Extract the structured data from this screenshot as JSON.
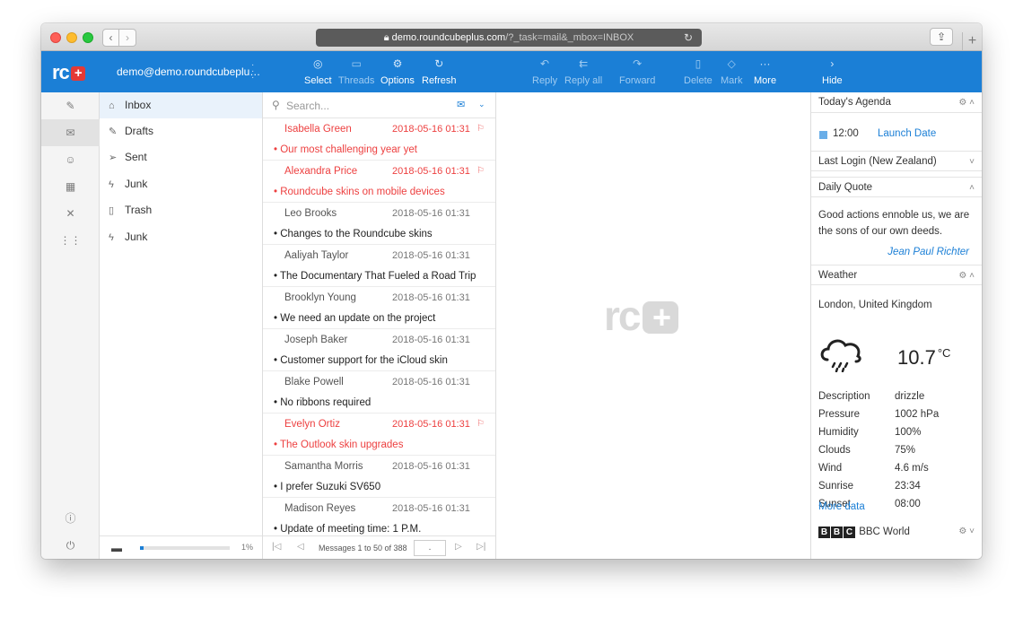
{
  "browser": {
    "url_host": "demo.roundcubeplus.com",
    "url_path": "/?_task=mail&_mbox=INBOX"
  },
  "toolbar": {
    "user": "demo@demo.roundcubeplu…",
    "buttons_left": [
      {
        "label": "Select",
        "icon": "check-circle-icon",
        "enabled": true
      },
      {
        "label": "Threads",
        "icon": "threads-icon",
        "enabled": false
      },
      {
        "label": "Options",
        "icon": "gear-icon",
        "enabled": true
      },
      {
        "label": "Refresh",
        "icon": "refresh-icon",
        "enabled": true
      }
    ],
    "buttons_right": [
      {
        "label": "Reply",
        "icon": "reply-icon",
        "enabled": false
      },
      {
        "label": "Reply all",
        "icon": "reply-all-icon",
        "enabled": false
      },
      {
        "label": "Forward",
        "icon": "forward-icon",
        "enabled": false
      },
      {
        "label": "Delete",
        "icon": "trash-icon",
        "enabled": false
      },
      {
        "label": "Mark",
        "icon": "tag-icon",
        "enabled": false
      },
      {
        "label": "More",
        "icon": "more-icon",
        "enabled": true
      },
      {
        "label": "Hide",
        "icon": "chevron-right-icon",
        "enabled": true
      }
    ]
  },
  "folders": [
    {
      "name": "Inbox",
      "icon": "inbox-icon",
      "active": true
    },
    {
      "name": "Drafts",
      "icon": "edit-icon",
      "active": false
    },
    {
      "name": "Sent",
      "icon": "send-icon",
      "active": false
    },
    {
      "name": "Junk",
      "icon": "junk-icon",
      "active": false
    },
    {
      "name": "Trash",
      "icon": "trash-icon",
      "active": false
    },
    {
      "name": "Junk",
      "icon": "junk-icon",
      "active": false
    }
  ],
  "quota": {
    "percent_label": "1%",
    "fill": 0.04
  },
  "search": {
    "placeholder": "Search..."
  },
  "messages": [
    {
      "from": "Isabella Green",
      "date": "2018-05-16 01:31",
      "subject": "Our most challenging year yet",
      "flagged": true
    },
    {
      "from": "Alexandra Price",
      "date": "2018-05-16 01:31",
      "subject": "Roundcube skins on mobile devices",
      "flagged": true
    },
    {
      "from": "Leo Brooks",
      "date": "2018-05-16 01:31",
      "subject": "Changes to the Roundcube skins",
      "flagged": false
    },
    {
      "from": "Aaliyah Taylor",
      "date": "2018-05-16 01:31",
      "subject": "The Documentary That Fueled a Road Trip",
      "flagged": false
    },
    {
      "from": "Brooklyn Young",
      "date": "2018-05-16 01:31",
      "subject": "We need an update on the project",
      "flagged": false
    },
    {
      "from": "Joseph Baker",
      "date": "2018-05-16 01:31",
      "subject": "Customer support for the iCloud skin",
      "flagged": false
    },
    {
      "from": "Blake Powell",
      "date": "2018-05-16 01:31",
      "subject": "No ribbons required",
      "flagged": false
    },
    {
      "from": "Evelyn Ortiz",
      "date": "2018-05-16 01:31",
      "subject": "The Outlook skin upgrades",
      "flagged": true
    },
    {
      "from": "Samantha Morris",
      "date": "2018-05-16 01:31",
      "subject": "I prefer Suzuki SV650",
      "flagged": false
    },
    {
      "from": "Madison Reyes",
      "date": "2018-05-16 01:31",
      "subject": "Update of meeting time: 1 P.M.",
      "flagged": false
    }
  ],
  "pager": {
    "count": "Messages 1 to 50 of 388",
    "page": "."
  },
  "right_panel": {
    "agenda": {
      "title": "Today's Agenda",
      "time": "12:00",
      "event": "Launch Date"
    },
    "last_login": {
      "title": "Last Login",
      "location": "(New Zealand)"
    },
    "quote": {
      "title": "Daily Quote",
      "line1": "Good actions ennoble us, we are",
      "line2": "the sons of our own deeds.",
      "author": "Jean Paul Richter"
    },
    "weather": {
      "title": "Weather",
      "location": "London, United Kingdom",
      "temperature": "10.7",
      "unit": "°C",
      "rows": [
        {
          "label": "Description",
          "value": "drizzle"
        },
        {
          "label": "Pressure",
          "value": "1002 hPa"
        },
        {
          "label": "Humidity",
          "value": "100%"
        },
        {
          "label": "Clouds",
          "value": "75%"
        },
        {
          "label": "Wind",
          "value": "4.6 m/s"
        },
        {
          "label": "Sunrise",
          "value": "23:34"
        },
        {
          "label": "Sunset",
          "value": "08:00"
        }
      ],
      "more": "More data"
    },
    "bbc": {
      "title": "BBC World",
      "logo": [
        "B",
        "B",
        "C"
      ]
    }
  },
  "colors": {
    "accent": "#1b7fd6",
    "flagged": "#ed4040",
    "logo_plus": "#e53935"
  }
}
